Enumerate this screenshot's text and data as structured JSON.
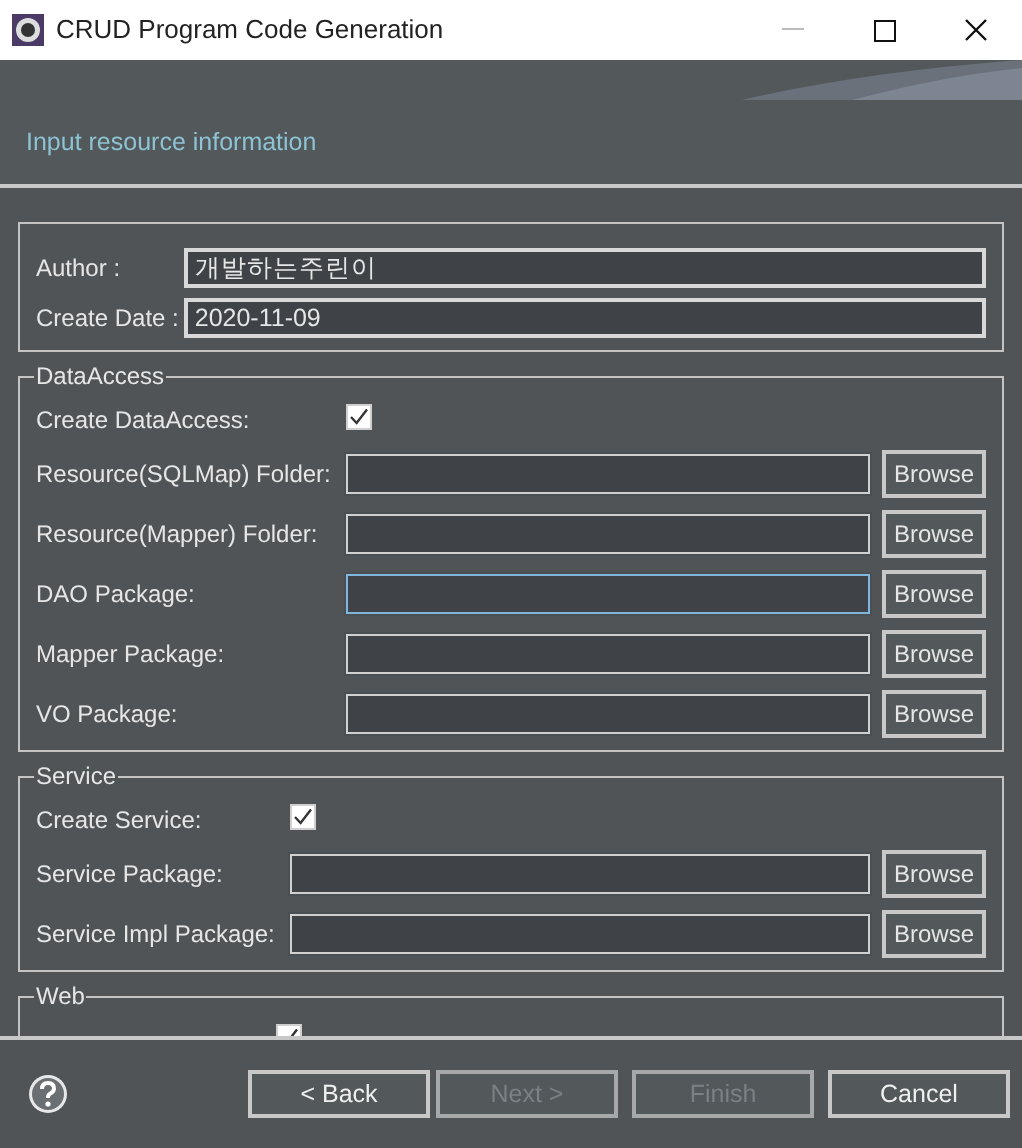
{
  "window": {
    "title": "CRUD Program Code Generation"
  },
  "header": {
    "title": "Input resource information"
  },
  "info_group": {
    "fields": [
      {
        "label": "Author :",
        "value": "개발하는주린이"
      },
      {
        "label": "Create Date :",
        "value": "2020-11-09"
      }
    ]
  },
  "groups": [
    {
      "title": "DataAccess",
      "rows": [
        {
          "kind": "checkbox",
          "label": "Create DataAccess:",
          "checked": true
        },
        {
          "kind": "path",
          "label": "Resource(SQLMap) Folder:",
          "focused": false,
          "button": "Browse"
        },
        {
          "kind": "path",
          "label": "Resource(Mapper) Folder:",
          "focused": false,
          "button": "Browse"
        },
        {
          "kind": "path",
          "label": "DAO Package:",
          "focused": true,
          "button": "Browse"
        },
        {
          "kind": "path",
          "label": "Mapper Package:",
          "focused": false,
          "button": "Browse"
        },
        {
          "kind": "path",
          "label": "VO Package:",
          "focused": false,
          "button": "Browse"
        }
      ]
    },
    {
      "title": "Service",
      "rows": [
        {
          "kind": "checkbox",
          "label": "Create Service:",
          "checked": true
        },
        {
          "kind": "path",
          "label": "Service Package:",
          "focused": false,
          "button": "Browse"
        },
        {
          "kind": "path",
          "label": "Service Impl Package:",
          "focused": false,
          "button": "Browse"
        }
      ]
    },
    {
      "title": "Web",
      "rows": [
        {
          "kind": "checkbox",
          "checked": true
        }
      ]
    }
  ],
  "footer": {
    "buttons": [
      {
        "label": "< Back",
        "disabled": false
      },
      {
        "label": "Next >",
        "disabled": true
      },
      {
        "label": "Finish",
        "disabled": true
      },
      {
        "label": "Cancel",
        "disabled": false
      }
    ]
  }
}
